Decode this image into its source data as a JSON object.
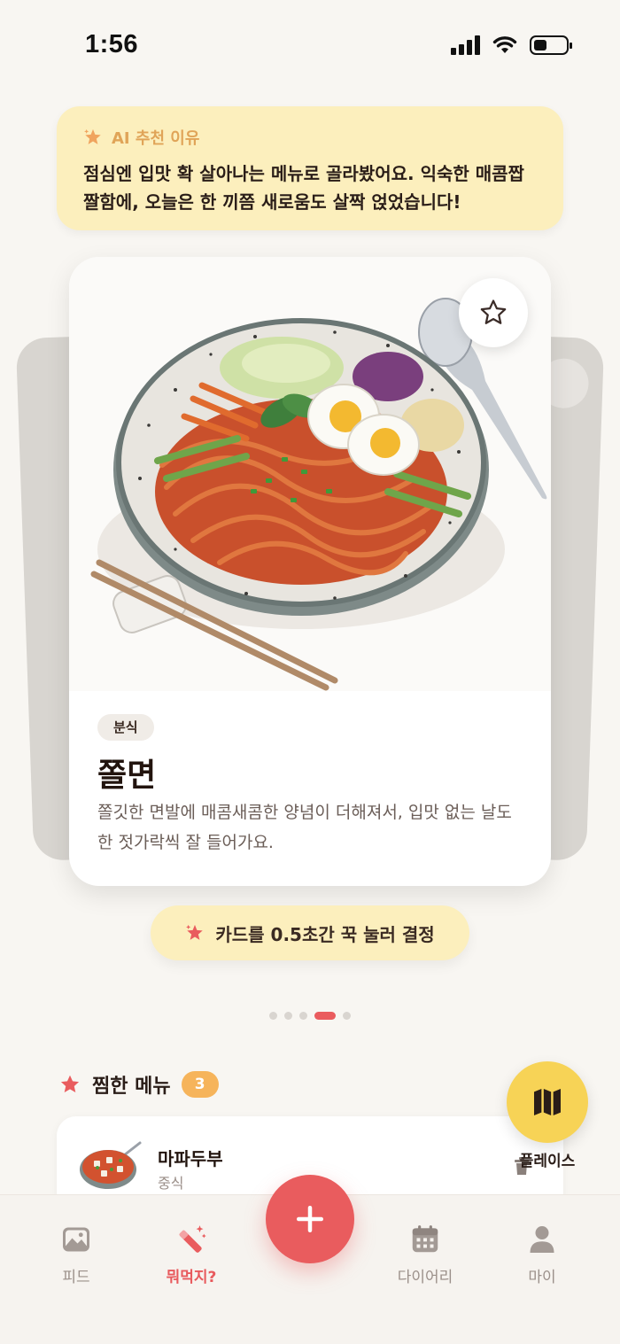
{
  "status_bar": {
    "time": "1:56"
  },
  "ai_reason": {
    "label": "AI 추천 이유",
    "text": "점심엔 입맛 확 살아나는 메뉴로 골라봤어요. 익숙한 매콤짭짤함에, 오늘은 한 끼쯤 새로움도 살짝 얹었습니다!"
  },
  "card": {
    "category": "분식",
    "name": "쫄면",
    "description": "쫄깃한 면발에 매콤새콤한 양념이 더해져서, 입맛 없는 날도 한 젓가락씩 잘 들어가요.",
    "favorite_icon": "star-outline-icon"
  },
  "hint": {
    "text": "카드를 0.5초간 꾹 눌러 결정"
  },
  "pagination": {
    "count": 5,
    "active_index": 3
  },
  "favorites": {
    "title": "찜한 메뉴",
    "count": "3",
    "items": [
      {
        "name": "마파두부",
        "category": "중식"
      }
    ]
  },
  "places": {
    "label": "플레이스"
  },
  "nav": {
    "items": [
      {
        "label": "피드",
        "icon": "image-icon"
      },
      {
        "label": "뭐먹지?",
        "icon": "magic-wand-icon"
      },
      {
        "label": "다이어리",
        "icon": "calendar-icon"
      },
      {
        "label": "마이",
        "icon": "person-icon"
      }
    ],
    "active": "뭐먹지?"
  },
  "colors": {
    "accent": "#e95c5e",
    "yellow_soft": "#fcefbd",
    "yellow": "#f7d356",
    "badge_orange": "#f6b45b"
  }
}
